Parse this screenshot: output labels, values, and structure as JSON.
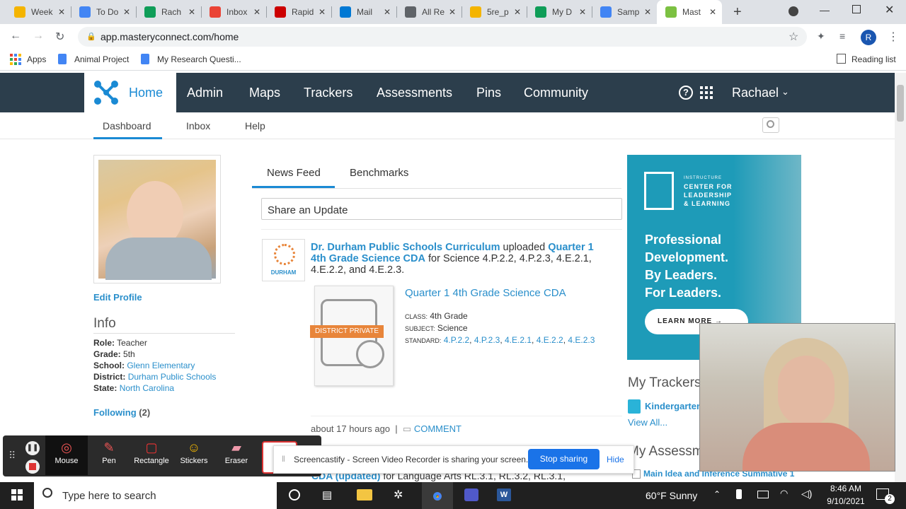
{
  "browser": {
    "tabs": [
      {
        "title": "Week",
        "color": "#f4b400"
      },
      {
        "title": "To Do",
        "color": "#4285f4"
      },
      {
        "title": "Rach",
        "color": "#0f9d58"
      },
      {
        "title": "Inbox",
        "color": "#ea4335"
      },
      {
        "title": "Rapid",
        "color": "#c00"
      },
      {
        "title": "Mail",
        "color": "#0078d4"
      },
      {
        "title": "All Re",
        "color": "#5f6368"
      },
      {
        "title": "5re_p",
        "color": "#f4b400"
      },
      {
        "title": "My D",
        "color": "#0f9d58"
      },
      {
        "title": "Samp",
        "color": "#4285f4"
      },
      {
        "title": "Mast",
        "color": "#7cc142"
      }
    ],
    "url": "app.masteryconnect.com/home",
    "bookmarks": [
      "Apps",
      "Animal Project",
      "My Research Questi..."
    ],
    "reading_list": "Reading list",
    "profile_initial": "R"
  },
  "mc_nav": {
    "home": "Home",
    "items": [
      "Admin",
      "Maps",
      "Trackers",
      "Assessments",
      "Pins",
      "Community"
    ],
    "user": "Rachael"
  },
  "subnav": [
    "Dashboard",
    "Inbox",
    "Help"
  ],
  "profile": {
    "edit": "Edit Profile",
    "info_heading": "Info",
    "role_label": "Role:",
    "role": "Teacher",
    "grade_label": "Grade:",
    "grade": "5th",
    "school_label": "School:",
    "school": "Glenn Elementary",
    "district_label": "District:",
    "district": "Durham Public Schools",
    "state_label": "State:",
    "state": "North Carolina",
    "following_label": "Following",
    "following_count": "(2)"
  },
  "feed": {
    "tabs": [
      "News Feed",
      "Benchmarks"
    ],
    "share_placeholder": "Share an Update",
    "post": {
      "author": "Dr. Durham Public Schools Curriculum",
      "verb": "uploaded",
      "item_line1": "Quarter 1",
      "item_line2": "4th Grade Science CDA",
      "rest_line1": "for Science 4.P.2.2, 4.P.2.3, 4.E.2.1,",
      "rest_line2": "4.E.2.2, and 4.E.2.3.",
      "logo_text": "DURHAM",
      "card_title": "Quarter 1 4th Grade Science CDA",
      "badge": "DISTRICT PRIVATE",
      "class_label": "CLASS:",
      "class": "4th Grade",
      "subject_label": "SUBJECT:",
      "subject": "Science",
      "standard_label": "STANDARD:",
      "standards": [
        "4.P.2.2",
        "4.P.2.3",
        "4.E.2.1",
        "4.E.2.2",
        "4.E.2.3"
      ],
      "time": "about 17 hours ago",
      "sep": "|",
      "comment": "COMMENT",
      "next_post_fragment": "CDA (updated)",
      "next_post_rest": "for Language Arts RL.3.1, RL.3.2, RL.3.1,"
    }
  },
  "ad": {
    "brand_top": "INSTRUCTURE",
    "brand_line1": "CENTER FOR",
    "brand_line2": "LEADERSHIP",
    "brand_line3": "& LEARNING",
    "headline": [
      "Professional",
      "Development.",
      "By Leaders.",
      "For Leaders."
    ],
    "cta": "LEARN MORE",
    "bg": "#1e9bb8"
  },
  "sidebar": {
    "trackers_heading": "My Trackers",
    "tracker_item": "Kindergarten",
    "view_all": "View All...",
    "assess_heading": "My Assessm",
    "assess_item": "Main Idea and Inference Summative 1"
  },
  "screencastify": {
    "tools": [
      "Mouse",
      "Pen",
      "Rectangle",
      "Stickers",
      "Eraser"
    ],
    "share_msg": "Screencastify - Screen Video Recorder is sharing your screen.",
    "stop": "Stop sharing",
    "hide": "Hide"
  },
  "taskbar": {
    "search": "Type here to search",
    "weather": "60°F  Sunny",
    "time": "8:46 AM",
    "date": "9/10/2021",
    "notif": "2"
  }
}
